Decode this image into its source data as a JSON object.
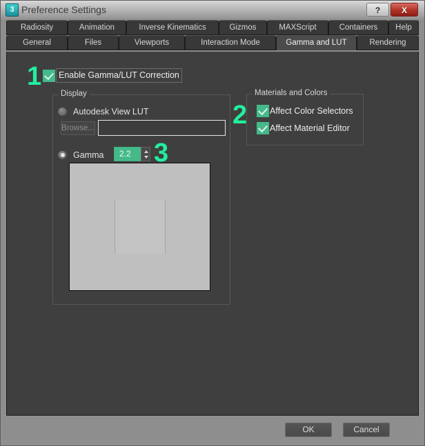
{
  "window": {
    "title": "Preference Settings",
    "icon": "max-3-icon",
    "help_label": "?",
    "close_label": "X"
  },
  "tabs": {
    "row1": [
      {
        "label": "Radiosity",
        "active": false
      },
      {
        "label": "Animation",
        "active": false
      },
      {
        "label": "Inverse Kinematics",
        "active": false
      },
      {
        "label": "Gizmos",
        "active": false
      },
      {
        "label": "MAXScript",
        "active": false
      },
      {
        "label": "Containers",
        "active": false
      },
      {
        "label": "Help",
        "active": false
      }
    ],
    "row2": [
      {
        "label": "General",
        "active": false
      },
      {
        "label": "Files",
        "active": false
      },
      {
        "label": "Viewports",
        "active": false
      },
      {
        "label": "Interaction Mode",
        "active": false
      },
      {
        "label": "Gamma and LUT",
        "active": true
      },
      {
        "label": "Rendering",
        "active": false
      }
    ]
  },
  "enable": {
    "label": "Enable Gamma/LUT Correction",
    "checked": true
  },
  "display": {
    "group_title": "Display",
    "lut_radio_label": "Autodesk View LUT",
    "lut_radio_selected": false,
    "browse_label": "Browse...",
    "lut_path_value": "",
    "lut_path_placeholder": "",
    "gamma_radio_label": "Gamma",
    "gamma_radio_selected": true,
    "gamma_value": "2.2"
  },
  "materials": {
    "group_title": "Materials and Colors",
    "items": [
      {
        "label": "Affect Color Selectors",
        "checked": true
      },
      {
        "label": "Affect Material Editor",
        "checked": true
      }
    ]
  },
  "annotations": [
    {
      "id": "1",
      "text": "1"
    },
    {
      "id": "2",
      "text": "2"
    },
    {
      "id": "3",
      "text": "3"
    }
  ],
  "footer": {
    "ok_label": "OK",
    "cancel_label": "Cancel"
  },
  "colors": {
    "highlight_green": "#46b98a",
    "annotation_green": "#22efa0",
    "panel_bg": "#3f3f3f",
    "close_red": "#b03227"
  }
}
